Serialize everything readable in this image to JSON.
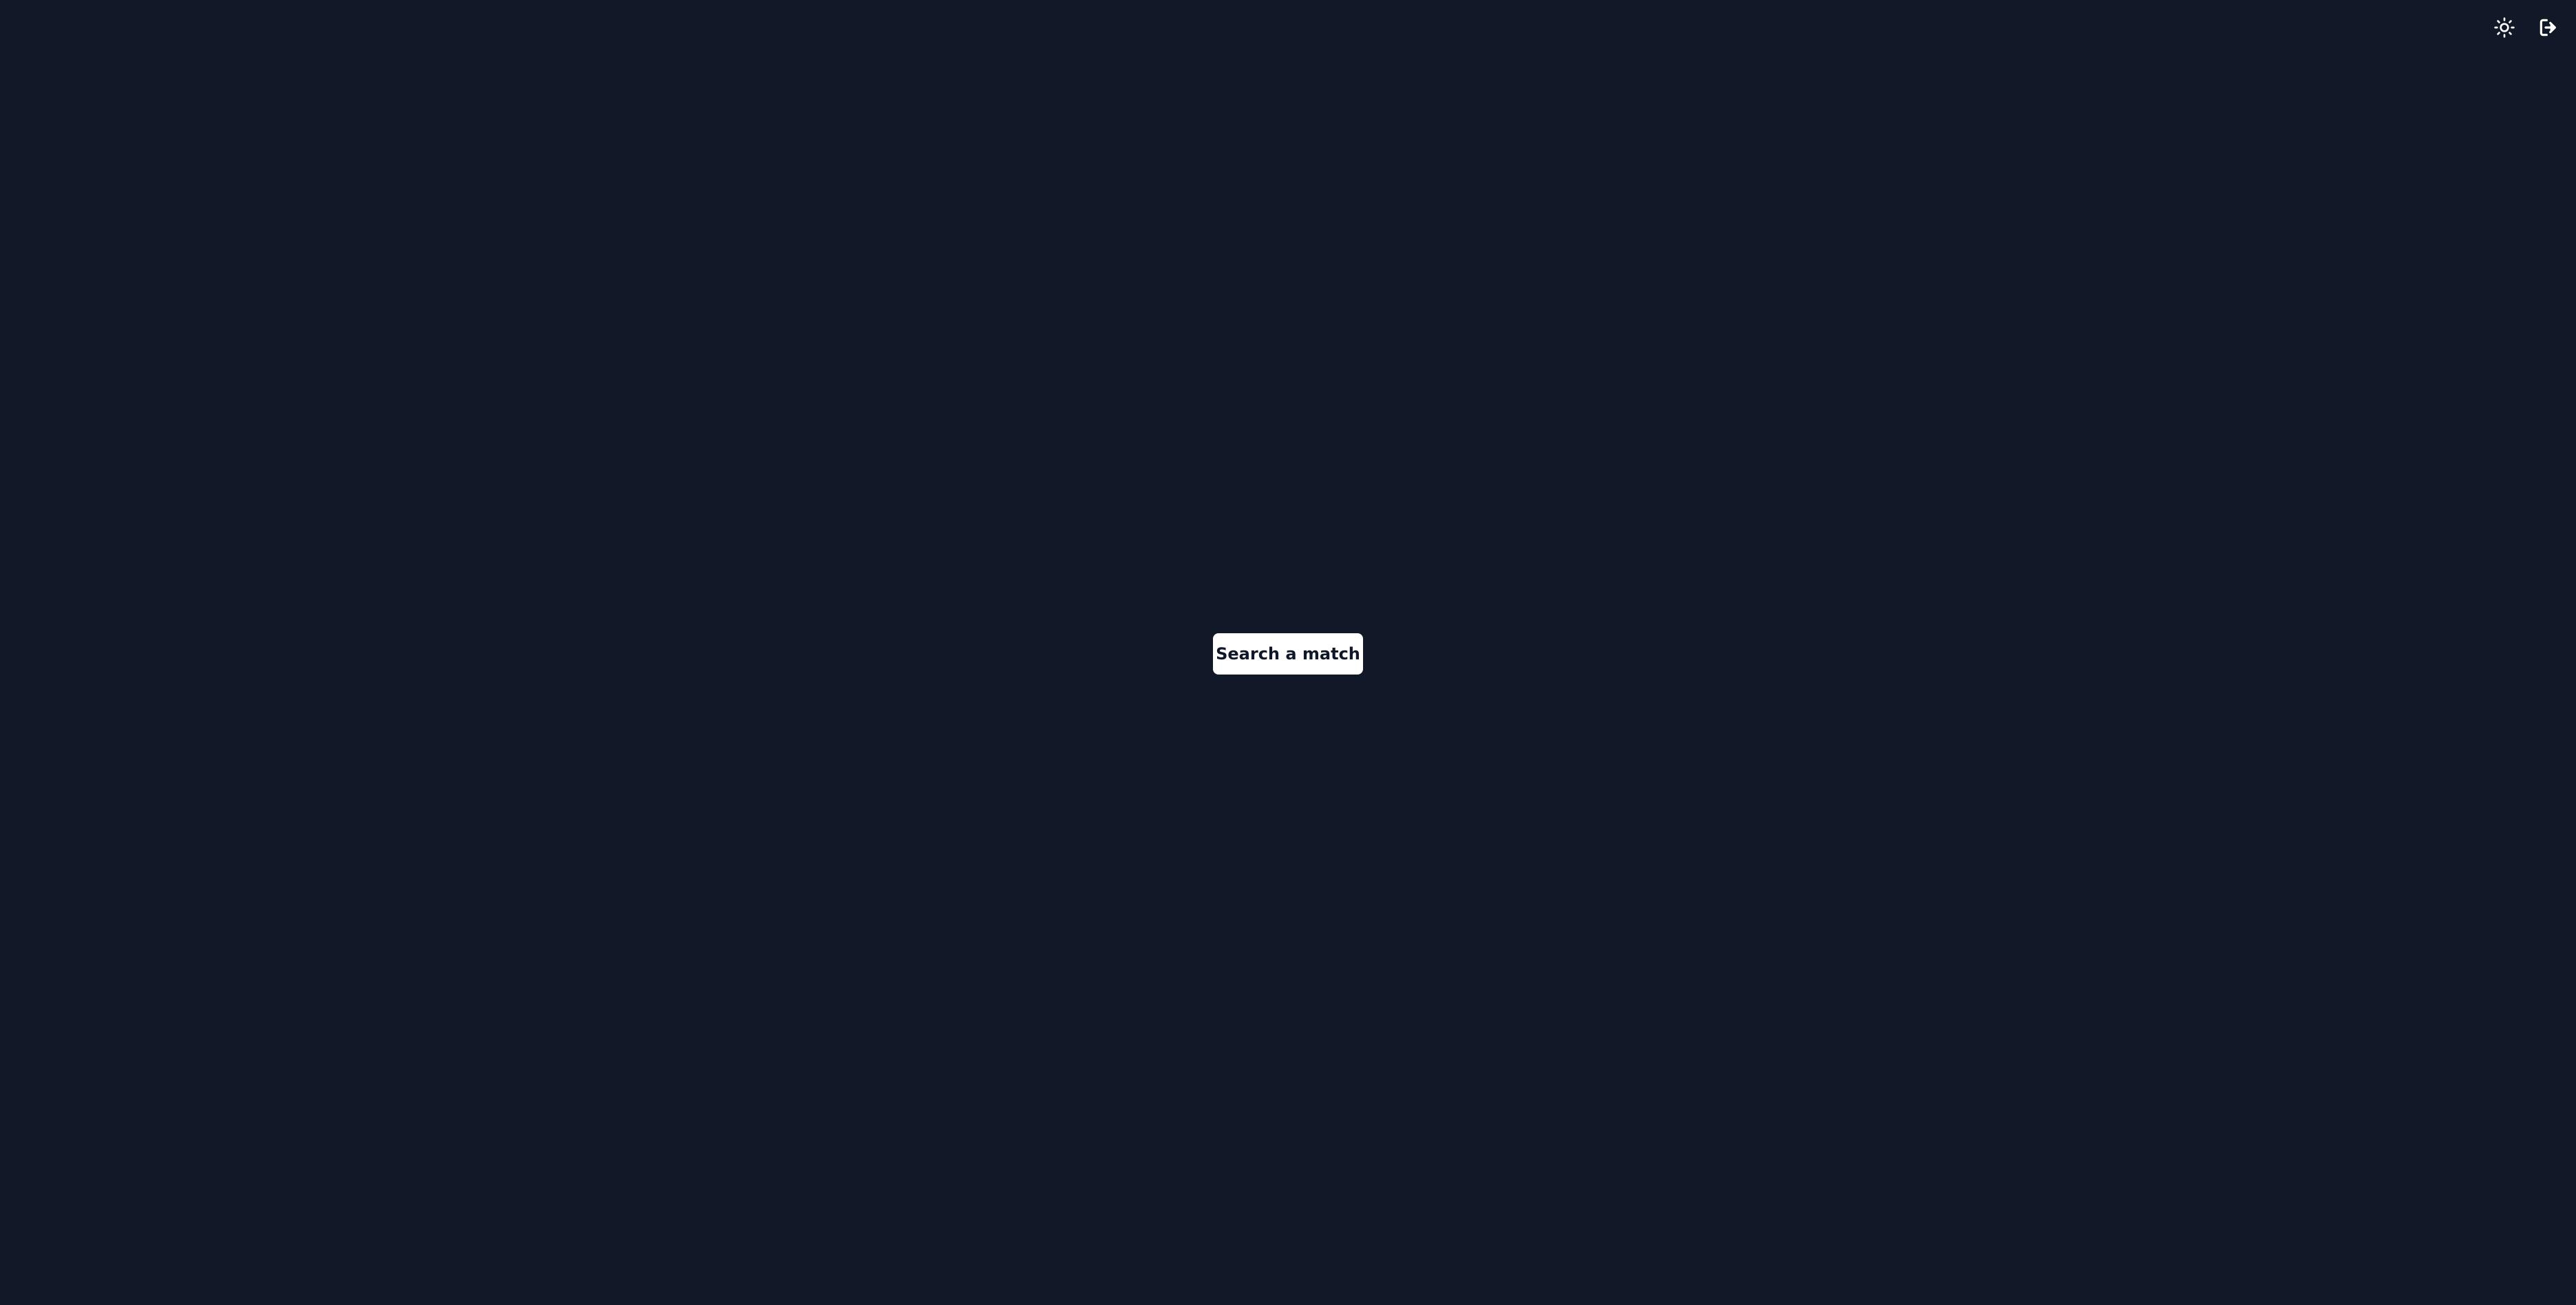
{
  "theme": {
    "background": "#111827",
    "icon_color": "#ffffff",
    "button_background": "#ffffff",
    "button_text_color": "#0f172a"
  },
  "header": {
    "theme_toggle_icon": "sun-icon",
    "logout_icon": "logout-icon"
  },
  "main": {
    "search_button_label": "Search a match"
  }
}
